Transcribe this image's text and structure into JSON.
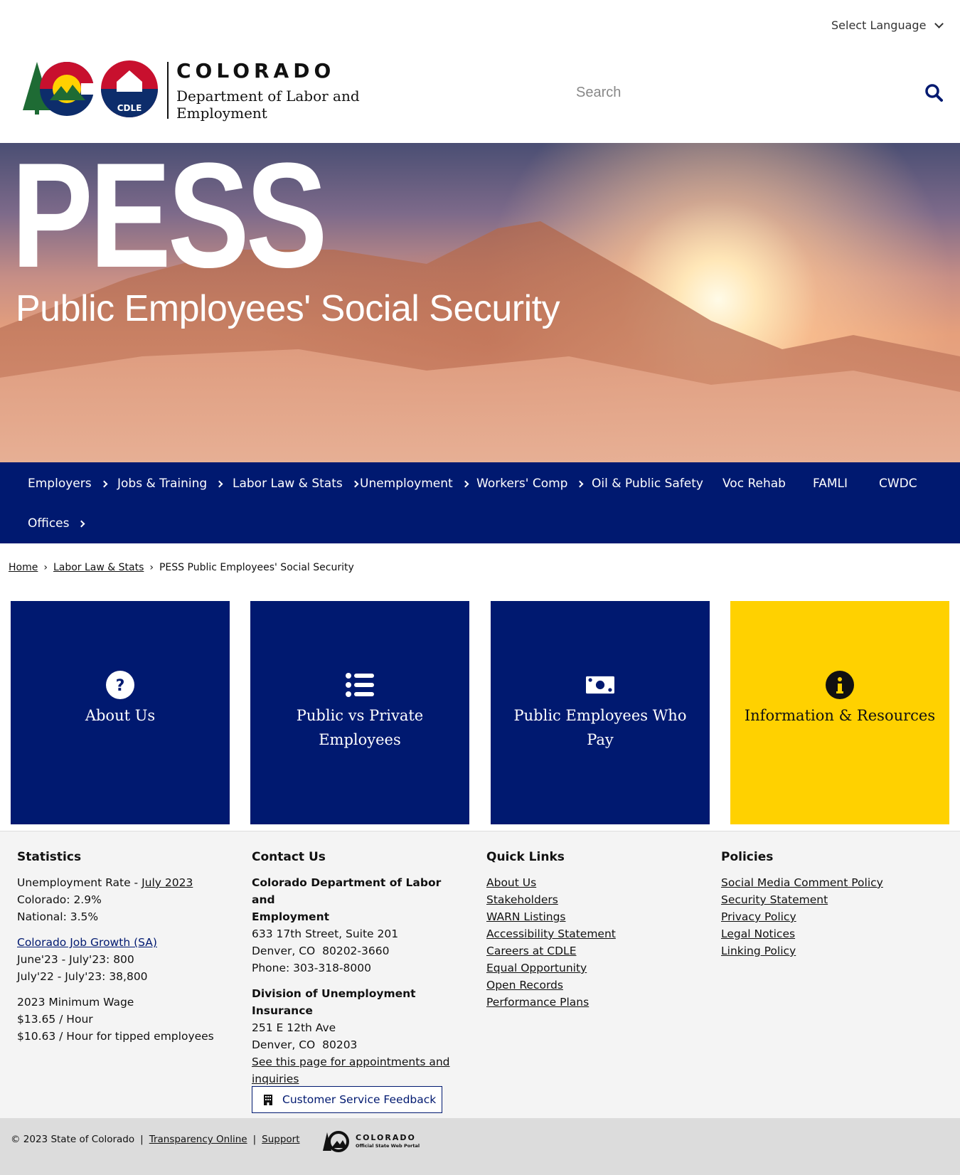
{
  "header": {
    "language_label": "Select Language",
    "logo_wordmark": "COLORADO",
    "logo_department": "Department of Labor and Employment",
    "logo_badge": "CDLE",
    "search_placeholder": "Search"
  },
  "hero": {
    "title": "PESS",
    "subtitle": "Public Employees' Social Security"
  },
  "nav": {
    "items": [
      {
        "label": "Employers",
        "has_submenu": true
      },
      {
        "label": "Jobs & Training",
        "has_submenu": true
      },
      {
        "label": "Labor Law & Stats",
        "has_submenu": true
      },
      {
        "label": "Unemployment",
        "has_submenu": true
      },
      {
        "label": "Workers' Comp",
        "has_submenu": true
      },
      {
        "label": "Oil & Public Safety",
        "has_submenu": false
      },
      {
        "label": "Voc Rehab",
        "has_submenu": false
      },
      {
        "label": "FAMLI",
        "has_submenu": false
      },
      {
        "label": "CWDC",
        "has_submenu": false
      },
      {
        "label": "Offices",
        "has_submenu": true
      }
    ]
  },
  "breadcrumb": {
    "home": "Home",
    "section": "Labor Law & Stats",
    "current": "PESS Public Employees' Social Security"
  },
  "tiles": [
    {
      "label": "About Us",
      "icon": "question-circle-icon"
    },
    {
      "label": "Public vs Private Employees",
      "icon": "list-icon"
    },
    {
      "label": "Public Employees Who Pay",
      "icon": "money-bill-icon"
    },
    {
      "label": "Information & Resources",
      "icon": "info-circle-icon"
    }
  ],
  "colors": {
    "navy": "#001970",
    "yellow": "#ffd100"
  },
  "footer": {
    "statistics": {
      "heading": "Statistics",
      "unemployment_prefix": "Unemployment Rate - ",
      "unemployment_month": "July 2023",
      "colorado": "Colorado: 2.9%",
      "national": "National: 3.5%",
      "job_growth_link": "Colorado Job Growth (SA)",
      "job_growth_1": "June'23 - July'23: 800",
      "job_growth_2": "July'22 - July'23: 38,800",
      "min_wage_title": "2023 Minimum Wage",
      "min_wage_1": "$13.65 / Hour",
      "min_wage_2": "$10.63 / Hour for tipped employees"
    },
    "contact": {
      "heading": "Contact Us",
      "org1_line1": "Colorado Department of Labor and",
      "org1_line2": "Employment",
      "org1_address1": "633 17th Street, Suite 201",
      "org1_address2": "Denver, CO  80202-3660",
      "org1_phone": "Phone: 303-318-8000",
      "org2_name": "Division of Unemployment Insurance",
      "org2_address1": "251 E 12th Ave",
      "org2_address2": "Denver, CO  80203",
      "appointments_link_1": "See this page for appointments and",
      "appointments_link_2": "inquiries",
      "feedback_button": "Customer Service Feedback"
    },
    "quick_links": {
      "heading": "Quick Links",
      "items": [
        "About Us",
        "Stakeholders",
        "WARN Listings",
        "Accessibility Statement",
        "Careers at CDLE",
        "Equal Opportunity",
        "Open Records",
        "Performance Plans"
      ]
    },
    "policies": {
      "heading": "Policies",
      "items": [
        "Social Media Comment Policy",
        "Security Statement",
        "Privacy Policy",
        "Legal Notices",
        "Linking Policy"
      ]
    }
  },
  "bottom": {
    "copyright": "© 2023 State of Colorado",
    "separator": "|",
    "transparency": "Transparency Online",
    "support": "Support",
    "state_logo_name": "COLORADO",
    "state_logo_sub": "Official State Web Portal"
  }
}
